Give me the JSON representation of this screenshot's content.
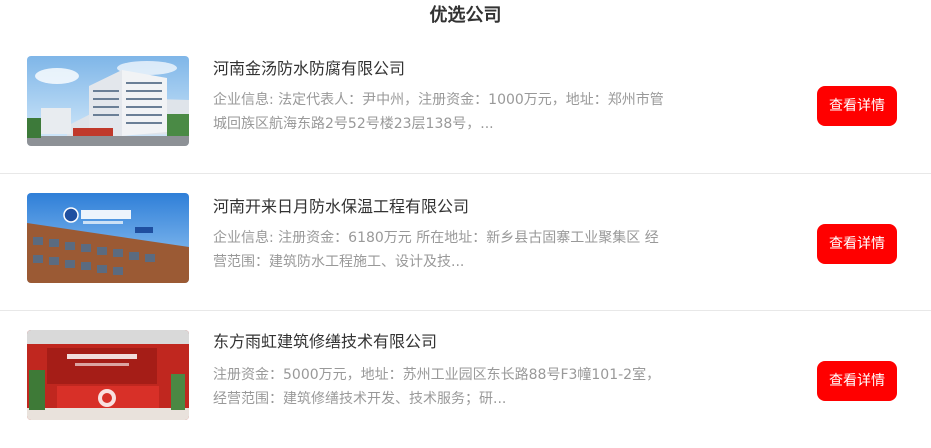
{
  "header": {
    "title": "优选公司"
  },
  "companies": [
    {
      "name": "河南金汤防水防腐有限公司",
      "desc": "企业信息: 法定代表人：尹中州，注册资金：1000万元，地址：郑州市管城回族区航海东路2号52号楼23层138号，...",
      "button": "查看详情"
    },
    {
      "name": "河南开来日月防水保温工程有限公司",
      "desc": "企业信息: 注册资金：6180万元 所在地址：新乡县古固寨工业聚集区 经营范围：建筑防水工程施工、设计及技...",
      "button": "查看详情"
    },
    {
      "name": "东方雨虹建筑修缮技术有限公司",
      "desc": "注册资金：5000万元，地址：苏州工业园区东长路88号F3幢101-2室，经营范围：建筑修缮技术开发、技术服务；研...",
      "button": "查看详情"
    }
  ]
}
